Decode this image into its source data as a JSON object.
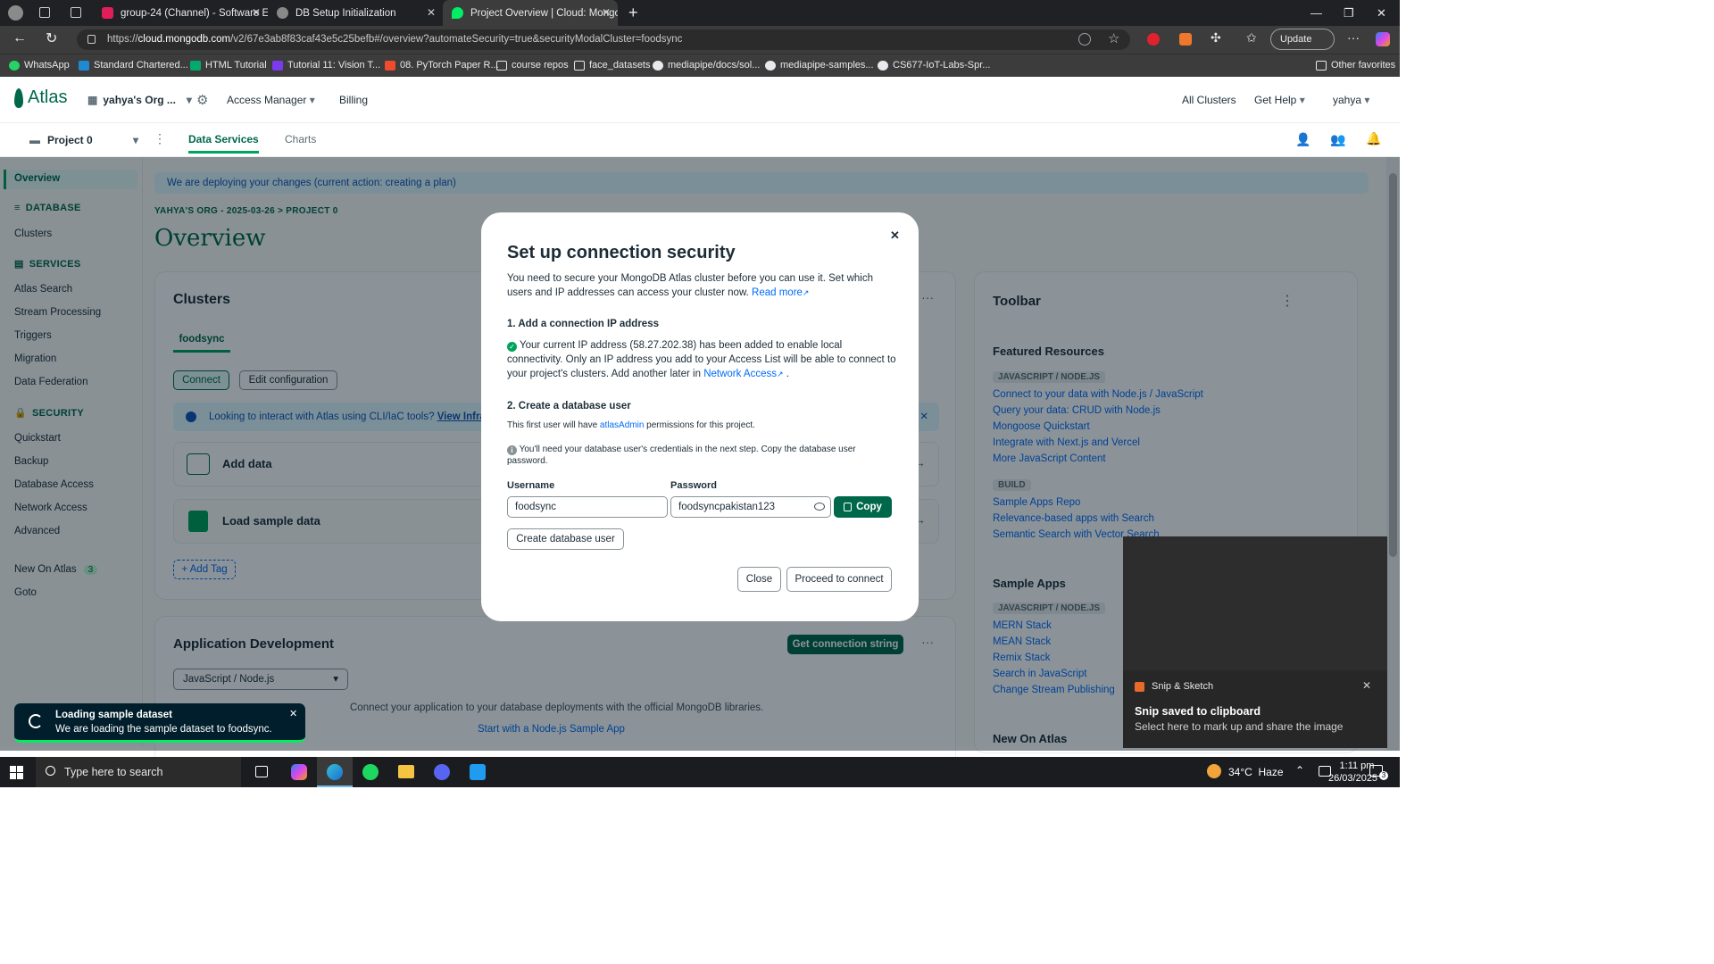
{
  "browser": {
    "tabs": [
      {
        "title": "group-24 (Channel) - Software En",
        "active": false
      },
      {
        "title": "DB Setup Initialization",
        "active": false
      },
      {
        "title": "Project Overview | Cloud: Mongo",
        "active": true
      }
    ],
    "url_prefix": "https://",
    "url_domain": "cloud.mongodb.com",
    "url_path": "/v2/67e3ab8f83caf43e5c25befb#/overview?automateSecurity=true&securityModalCluster=foodsync",
    "update_label": "Update",
    "bookmarks": [
      "WhatsApp",
      "Standard Chartered...",
      "HTML Tutorial",
      "Tutorial 11: Vision T...",
      "08. PyTorch Paper R...",
      "course repos",
      "face_datasets",
      "mediapipe/docs/sol...",
      "mediapipe-samples...",
      "CS677-IoT-Labs-Spr..."
    ],
    "other_favorites": "Other favorites"
  },
  "atlas": {
    "logo": "Atlas",
    "org": "yahya's Org ...",
    "access_manager": "Access Manager",
    "billing": "Billing",
    "all_clusters": "All Clusters",
    "get_help": "Get Help",
    "user": "yahya",
    "project": "Project 0",
    "nav_tabs": [
      "Data Services",
      "Charts"
    ]
  },
  "sidebar": {
    "overview": "Overview",
    "database_head": "DATABASE",
    "clusters": "Clusters",
    "services_head": "SERVICES",
    "services": [
      "Atlas Search",
      "Stream Processing",
      "Triggers",
      "Migration",
      "Data Federation"
    ],
    "security_head": "SECURITY",
    "security": [
      "Quickstart",
      "Backup",
      "Database Access",
      "Network Access",
      "Advanced"
    ],
    "new_on_atlas": "New On Atlas",
    "new_count": "3",
    "goto": "Goto"
  },
  "main": {
    "banner": "We are deploying your changes (current action: creating a plan)",
    "breadcrumb": "YAHYA'S ORG - 2025-03-26 > PROJECT 0",
    "title": "Overview",
    "clusters_title": "Clusters",
    "cluster_tab": "foodsync",
    "connect": "Connect",
    "edit_config": "Edit configuration",
    "cli_info": "Looking to interact with Atlas using CLI/IaC tools?",
    "cli_link": "View Infra",
    "add_data": "Add data",
    "load_sample": "Load sample data",
    "add_tag": "+ Add Tag",
    "app_dev_title": "Application Development",
    "get_conn_string": "Get connection string",
    "lang_select": "JavaScript / Node.js",
    "app_desc": "Connect your application to your database deployments with the official MongoDB libraries.",
    "app_link": "Start with a Node.js Sample App"
  },
  "toolbar": {
    "title": "Toolbar",
    "featured": "Featured Resources",
    "js_head": "JAVASCRIPT / NODE.JS",
    "js_links": [
      "Connect to your data with Node.js / JavaScript",
      "Query your data: CRUD with Node.js",
      "Mongoose Quickstart",
      "Integrate with Next.js and Vercel",
      "More JavaScript Content"
    ],
    "build_head": "BUILD",
    "build_links": [
      "Sample Apps Repo",
      "Relevance-based apps with Search",
      "Semantic Search with Vector Search"
    ],
    "sample_apps": "Sample Apps",
    "sample_head": "JAVASCRIPT / NODE.JS",
    "sample_links": [
      "MERN Stack",
      "MEAN Stack",
      "Remix Stack",
      "Search in JavaScript",
      "Change Stream Publishing"
    ],
    "new_on_atlas": "New On Atlas"
  },
  "modal": {
    "title": "Set up connection security",
    "intro": "You need to secure your MongoDB Atlas cluster before you can use it. Set which users and IP addresses can access your cluster now.",
    "read_more": "Read more",
    "step1": "1. Add a connection IP address",
    "ip_text": "Your current IP address (58.27.202.38) has been added to enable local connectivity. Only an IP address you add to your Access List will be able to connect to your project's clusters. Add another later in",
    "network_access": "Network Access",
    "step2": "2. Create a database user",
    "perm_pre": "This first user will have",
    "perm_link": "atlasAdmin",
    "perm_post": "permissions for this project.",
    "cred_note": "You'll need your database user's credentials in the next step. Copy the database user password.",
    "username_label": "Username",
    "username_value": "foodsync",
    "password_label": "Password",
    "password_value": "foodsyncpakistan123",
    "copy": "Copy",
    "create_user": "Create database user",
    "close": "Close",
    "proceed": "Proceed to connect"
  },
  "toast": {
    "title": "Loading sample dataset",
    "body": "We are loading the sample dataset to foodsync."
  },
  "snip": {
    "app": "Snip & Sketch",
    "title": "Snip saved to clipboard",
    "body": "Select here to mark up and share the image"
  },
  "taskbar": {
    "search": "Type here to search",
    "weather": "34°C  Haze",
    "time": "1:11 pm",
    "date": "26/03/2025",
    "notif_count": "3"
  },
  "colors": {
    "brand_green": "#00684a",
    "accent_green": "#00ed64",
    "link_blue": "#016bf8"
  }
}
